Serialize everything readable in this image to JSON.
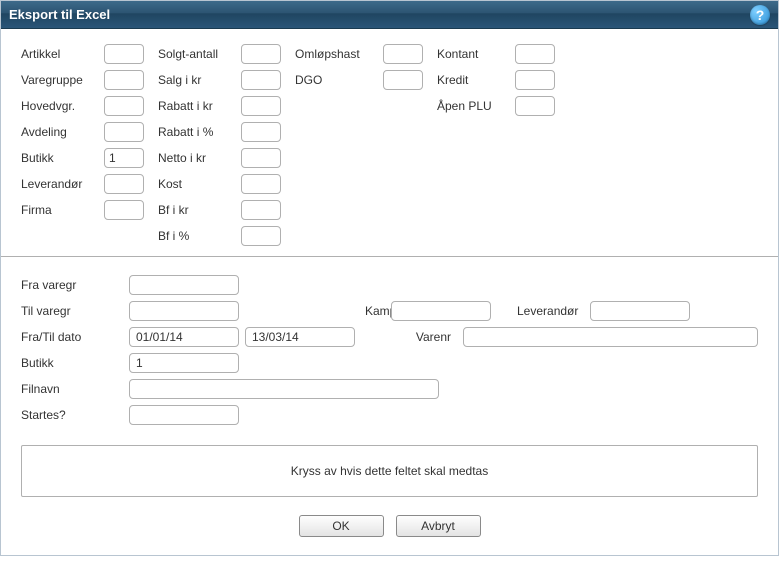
{
  "window": {
    "title": "Eksport til Excel"
  },
  "col1": {
    "artikkel": {
      "label": "Artikkel",
      "value": ""
    },
    "varegruppe": {
      "label": "Varegruppe",
      "value": ""
    },
    "hovedvgr": {
      "label": "Hovedvgr.",
      "value": ""
    },
    "avdeling": {
      "label": "Avdeling",
      "value": ""
    },
    "butikk": {
      "label": "Butikk",
      "value": "1"
    },
    "leverandor": {
      "label": "Leverandør",
      "value": ""
    },
    "firma": {
      "label": "Firma",
      "value": ""
    }
  },
  "col2": {
    "solgtantall": {
      "label": "Solgt-antall",
      "value": ""
    },
    "salgikr": {
      "label": "Salg i kr",
      "value": ""
    },
    "rabattikr": {
      "label": "Rabatt i kr",
      "value": ""
    },
    "rabattipct": {
      "label": "Rabatt i %",
      "value": ""
    },
    "nettoikr": {
      "label": "Netto i kr",
      "value": ""
    },
    "kost": {
      "label": "Kost",
      "value": ""
    },
    "bfikr": {
      "label": "Bf i kr",
      "value": ""
    },
    "bfipct": {
      "label": "Bf i %",
      "value": ""
    }
  },
  "col3": {
    "omlopshast": {
      "label": "Omløpshast",
      "value": ""
    },
    "dgo": {
      "label": "DGO",
      "value": ""
    }
  },
  "col4": {
    "kontant": {
      "label": "Kontant",
      "value": ""
    },
    "kredit": {
      "label": "Kredit",
      "value": ""
    },
    "apenplu": {
      "label": "Åpen PLU",
      "value": ""
    }
  },
  "lower": {
    "fravaregr": {
      "label": "Fra varegr",
      "value": ""
    },
    "tilvaregr": {
      "label": "Til varegr",
      "value": ""
    },
    "kampanje": {
      "label": "Kampanje",
      "value": ""
    },
    "leverandor": {
      "label": "Leverandør",
      "value": ""
    },
    "fratildato": {
      "label": "Fra/Til dato",
      "from": "01/01/14",
      "to": "13/03/14"
    },
    "varenr": {
      "label": "Varenr",
      "value": ""
    },
    "butikk": {
      "label": "Butikk",
      "value": "1"
    },
    "filnavn": {
      "label": "Filnavn",
      "value": ""
    },
    "startes": {
      "label": "Startes?",
      "value": ""
    }
  },
  "note": "Kryss av hvis dette feltet skal medtas",
  "buttons": {
    "ok": "OK",
    "cancel": "Avbryt"
  }
}
